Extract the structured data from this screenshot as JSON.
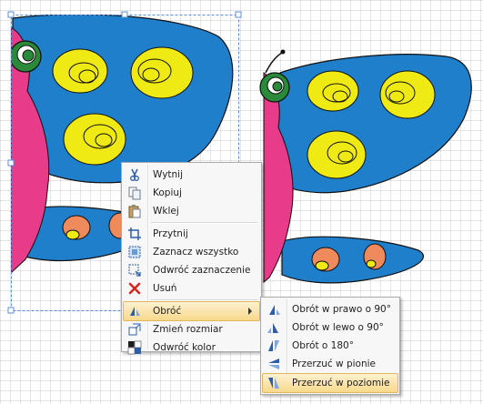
{
  "canvas": {
    "background": "#ffffff",
    "grid_color": "#b5b5b5",
    "selection_border": "#5b8fd6"
  },
  "colors": {
    "wing_blue": "#1f7fcb",
    "wing_pink": "#e83c8a",
    "spot_yellow": "#f0ea14",
    "spot_orange": "#ee8a5c",
    "head_green": "#2a8a3a",
    "outline": "#101010"
  },
  "context_menu": {
    "items": [
      {
        "label": "Wytnij",
        "icon": "scissors-icon"
      },
      {
        "label": "Kopiuj",
        "icon": "copy-icon"
      },
      {
        "label": "Wklej",
        "icon": "paste-icon"
      },
      {
        "label": "Przytnij",
        "icon": "crop-icon"
      },
      {
        "label": "Zaznacz wszystko",
        "icon": "select-all-icon"
      },
      {
        "label": "Odwróć zaznaczenie",
        "icon": "invert-selection-icon"
      },
      {
        "label": "Usuń",
        "icon": "delete-icon"
      },
      {
        "label": "Obróć",
        "icon": "rotate-icon",
        "highlighted": true,
        "submenu": true
      },
      {
        "label": "Zmień rozmiar",
        "icon": "resize-icon"
      },
      {
        "label": "Odwróć kolor",
        "icon": "invert-color-icon"
      }
    ]
  },
  "rotate_submenu": {
    "items": [
      {
        "label": "Obrót w prawo o 90°",
        "icon": "rotate-right-icon"
      },
      {
        "label": "Obrót w lewo o 90°",
        "icon": "rotate-left-icon"
      },
      {
        "label": "Obrót o 180°",
        "icon": "rotate-180-icon"
      },
      {
        "label": "Przerzuć w pionie",
        "icon": "flip-vertical-icon"
      },
      {
        "label": "Przerzuć w poziomie",
        "icon": "flip-horizontal-icon",
        "highlighted": true
      }
    ]
  }
}
